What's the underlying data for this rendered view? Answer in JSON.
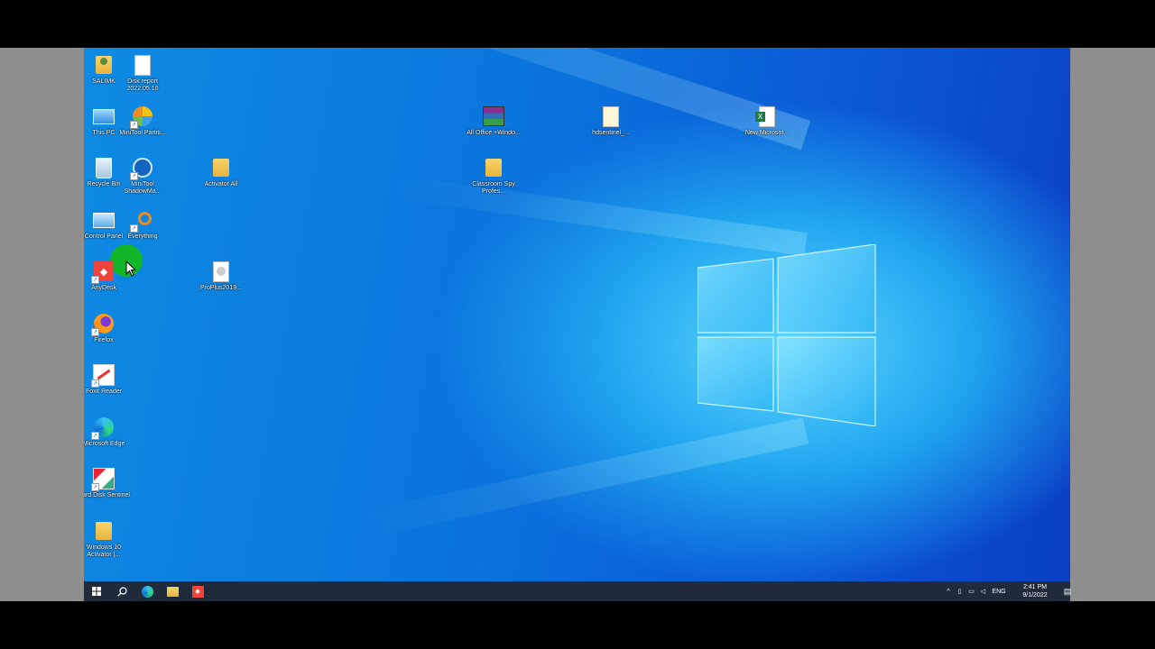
{
  "desktop": {
    "icons": [
      {
        "label": "SALIMK",
        "type": "user"
      },
      {
        "label": "Disk report 2022.05.10",
        "type": "doc"
      },
      {
        "label": "This PC",
        "type": "pc"
      },
      {
        "label": "MiniTool Partiti...",
        "type": "app"
      },
      {
        "label": "Recycle Bin",
        "type": "bin"
      },
      {
        "label": "MiniTool ShadowMa...",
        "type": "app"
      },
      {
        "label": "Activator All",
        "type": "folder"
      },
      {
        "label": "Control Panel",
        "type": "panel"
      },
      {
        "label": "Everything",
        "type": "search"
      },
      {
        "label": "AnyDesk",
        "type": "anydesk"
      },
      {
        "label": "ProPlus2019...",
        "type": "disc"
      },
      {
        "label": "Firefox",
        "type": "firefox"
      },
      {
        "label": "Foxit Reader",
        "type": "pdf"
      },
      {
        "label": "Microsoft Edge",
        "type": "edge"
      },
      {
        "label": "Hard Disk Sentinel",
        "type": "disk"
      },
      {
        "label": "Windows 10 Activator (...",
        "type": "folder"
      },
      {
        "label": "All Office +Windo...",
        "type": "rar"
      },
      {
        "label": "Classroom Spy Profes...",
        "type": "folder"
      },
      {
        "label": "hdsentinel_...",
        "type": "doc"
      },
      {
        "label": "New Microsof...",
        "type": "excel"
      }
    ]
  },
  "taskbar": {
    "start_icon": "windows-start-icon",
    "search_icon": "search-icon",
    "pinned": [
      "edge-icon",
      "file-explorer-icon",
      "anydesk-icon"
    ],
    "tray": {
      "language": "ENG",
      "time": "2:41 PM",
      "date": "9/1/2022"
    }
  },
  "colors": {
    "wallpaper_blue": "#0a73dc",
    "taskbar": "#1f2a3a",
    "pointer_highlight": "#12b81e"
  }
}
